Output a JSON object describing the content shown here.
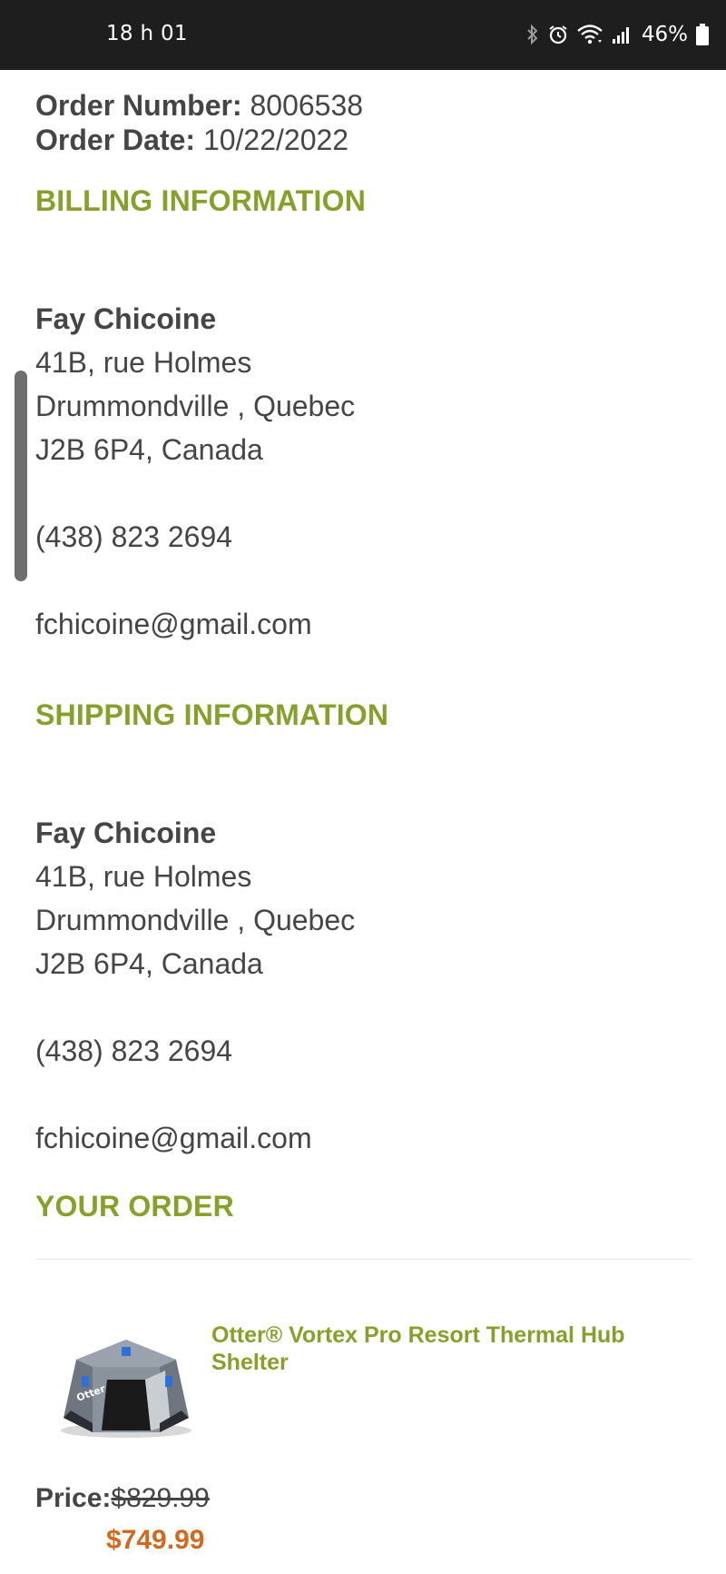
{
  "status_bar": {
    "time": "18 h 01",
    "battery": "46%",
    "icons": [
      "bluetooth-icon",
      "alarm-icon",
      "wifi-icon",
      "signal-icon",
      "battery-icon"
    ]
  },
  "order": {
    "number_label": "Order Number:",
    "number": "8006538",
    "date_label": "Order Date:",
    "date": "10/22/2022"
  },
  "billing": {
    "heading": "BILLING INFORMATION",
    "name": "Fay Chicoine",
    "street": "41B, rue Holmes",
    "city": "Drummondville , Quebec",
    "postal": "J2B 6P4, Canada",
    "phone": "(438) 823 2694",
    "email": "fchicoine@gmail.com"
  },
  "shipping": {
    "heading": "SHIPPING INFORMATION",
    "name": "Fay Chicoine",
    "street": "41B, rue Holmes",
    "city": "Drummondville , Quebec",
    "postal": "J2B 6P4, Canada",
    "phone": "(438) 823 2694",
    "email": "fchicoine@gmail.com"
  },
  "your_order": {
    "heading": "YOUR ORDER",
    "product_name": "Otter® Vortex Pro Resort Thermal Hub Shelter",
    "price_label": "Price:",
    "price_old": "$829.99",
    "price_new": "$749.99"
  },
  "colors": {
    "accent_green": "#86a12a",
    "sale_orange": "#d2691e",
    "text": "#454545",
    "status_bar": "#1e1e1e"
  }
}
